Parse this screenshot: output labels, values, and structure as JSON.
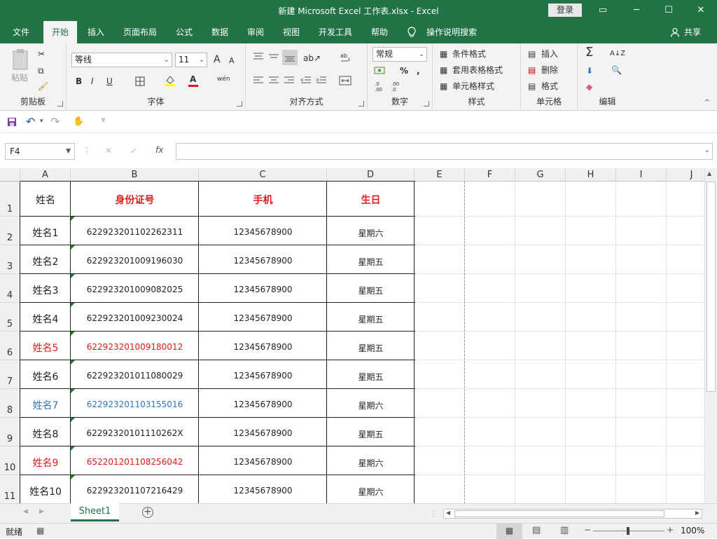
{
  "titlebar": {
    "title": "新建 Microsoft Excel 工作表.xlsx  -  Excel",
    "login": "登录",
    "win_restore": "▭",
    "win_min": "─",
    "win_max": "☐",
    "win_close": "✕"
  },
  "menu": {
    "tabs": [
      "文件",
      "开始",
      "插入",
      "页面布局",
      "公式",
      "数据",
      "审阅",
      "视图",
      "开发工具",
      "帮助"
    ],
    "active": "开始",
    "tell_me": "操作说明搜索",
    "share": "共享"
  },
  "ribbon": {
    "clipboard": {
      "label": "剪贴板",
      "paste": "粘贴"
    },
    "font": {
      "label": "字体",
      "font_name": "等线",
      "font_size": "11",
      "bold": "B",
      "italic": "I",
      "underline": "U",
      "grow": "A",
      "shrink": "A",
      "color_a": "A",
      "phonetic": "wén"
    },
    "alignment": {
      "label": "对齐方式"
    },
    "number": {
      "label": "数字",
      "format": "常规",
      "percent": "%",
      "comma": ","
    },
    "styles": {
      "label": "样式",
      "conditional": "条件格式",
      "table": "套用表格格式",
      "cell": "单元格样式"
    },
    "cells": {
      "label": "单元格",
      "insert": "插入",
      "delete": "删除",
      "format": "格式"
    },
    "editing": {
      "label": "编辑",
      "sum": "Σ",
      "sort": "A↓Z"
    }
  },
  "formula_bar": {
    "name_box": "F4",
    "fx": "fx",
    "cancel": "✕",
    "enter": "✓",
    "value": ""
  },
  "columns": [
    "A",
    "B",
    "C",
    "D",
    "E",
    "F",
    "G",
    "H",
    "I",
    "J"
  ],
  "rows": [
    "1",
    "2",
    "3",
    "4",
    "5",
    "6",
    "7",
    "8",
    "9",
    "10",
    "11"
  ],
  "table": {
    "header": [
      {
        "text": "姓名",
        "color": "#222222"
      },
      {
        "text": "身份证号",
        "color": "#e21b1b"
      },
      {
        "text": "手机",
        "color": "#e21b1b"
      },
      {
        "text": "生日",
        "color": "#e21b1b"
      }
    ],
    "rows": [
      {
        "name": "姓名1",
        "id": "622923201102262311",
        "phone": "12345678900",
        "birthday": "星期六",
        "color": "#222222"
      },
      {
        "name": "姓名2",
        "id": "622923201009196030",
        "phone": "12345678900",
        "birthday": "星期五",
        "color": "#222222"
      },
      {
        "name": "姓名3",
        "id": "622923201009082025",
        "phone": "12345678900",
        "birthday": "星期五",
        "color": "#222222"
      },
      {
        "name": "姓名4",
        "id": "622923201009230024",
        "phone": "12345678900",
        "birthday": "星期五",
        "color": "#222222"
      },
      {
        "name": "姓名5",
        "id": "622923201009180012",
        "phone": "12345678900",
        "birthday": "星期五",
        "color": "#e21b1b"
      },
      {
        "name": "姓名6",
        "id": "622923201011080029",
        "phone": "12345678900",
        "birthday": "星期五",
        "color": "#222222"
      },
      {
        "name": "姓名7",
        "id": "622923201103155016",
        "phone": "12345678900",
        "birthday": "星期六",
        "color": "#2e75b6"
      },
      {
        "name": "姓名8",
        "id": "62292320101110262X",
        "phone": "12345678900",
        "birthday": "星期五",
        "color": "#222222"
      },
      {
        "name": "姓名9",
        "id": "652201201108256042",
        "phone": "12345678900",
        "birthday": "星期六",
        "color": "#e21b1b"
      },
      {
        "name": "姓名10",
        "id": "622923201107216429",
        "phone": "12345678900",
        "birthday": "星期六",
        "color": "#222222"
      }
    ]
  },
  "sheet_tabs": [
    "Sheet1"
  ],
  "status": {
    "ready": "就绪",
    "zoom": "100%"
  },
  "colors": {
    "excel_green": "#217346",
    "ribbon_bg": "#f3f3f3",
    "red_text": "#e21b1b",
    "blue_text": "#2e75b6"
  }
}
